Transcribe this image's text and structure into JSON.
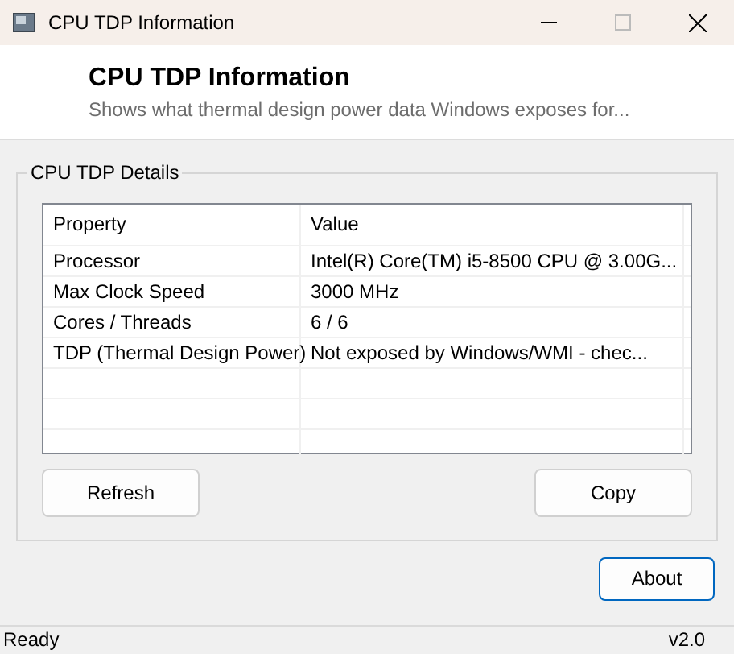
{
  "window": {
    "title": "CPU TDP Information"
  },
  "header": {
    "title": "CPU TDP Information",
    "subtitle": "Shows what thermal design power data Windows exposes for..."
  },
  "group": {
    "title": "CPU TDP Details"
  },
  "table": {
    "columns": [
      "Property",
      "Value"
    ],
    "rows": [
      [
        "Processor",
        "Intel(R) Core(TM) i5-8500 CPU @ 3.00G..."
      ],
      [
        "Max Clock Speed",
        "3000 MHz"
      ],
      [
        "Cores / Threads",
        "6 / 6"
      ],
      [
        "TDP (Thermal Design Power)",
        "Not exposed by Windows/WMI - chec..."
      ]
    ]
  },
  "group_buttons": [
    {
      "label": "Refresh",
      "focused": false
    },
    {
      "label": "Copy",
      "focused": false
    }
  ],
  "about_button": {
    "label": "About",
    "focused": true
  },
  "status_bar": {
    "status": "Ready",
    "version": "v2.0"
  }
}
